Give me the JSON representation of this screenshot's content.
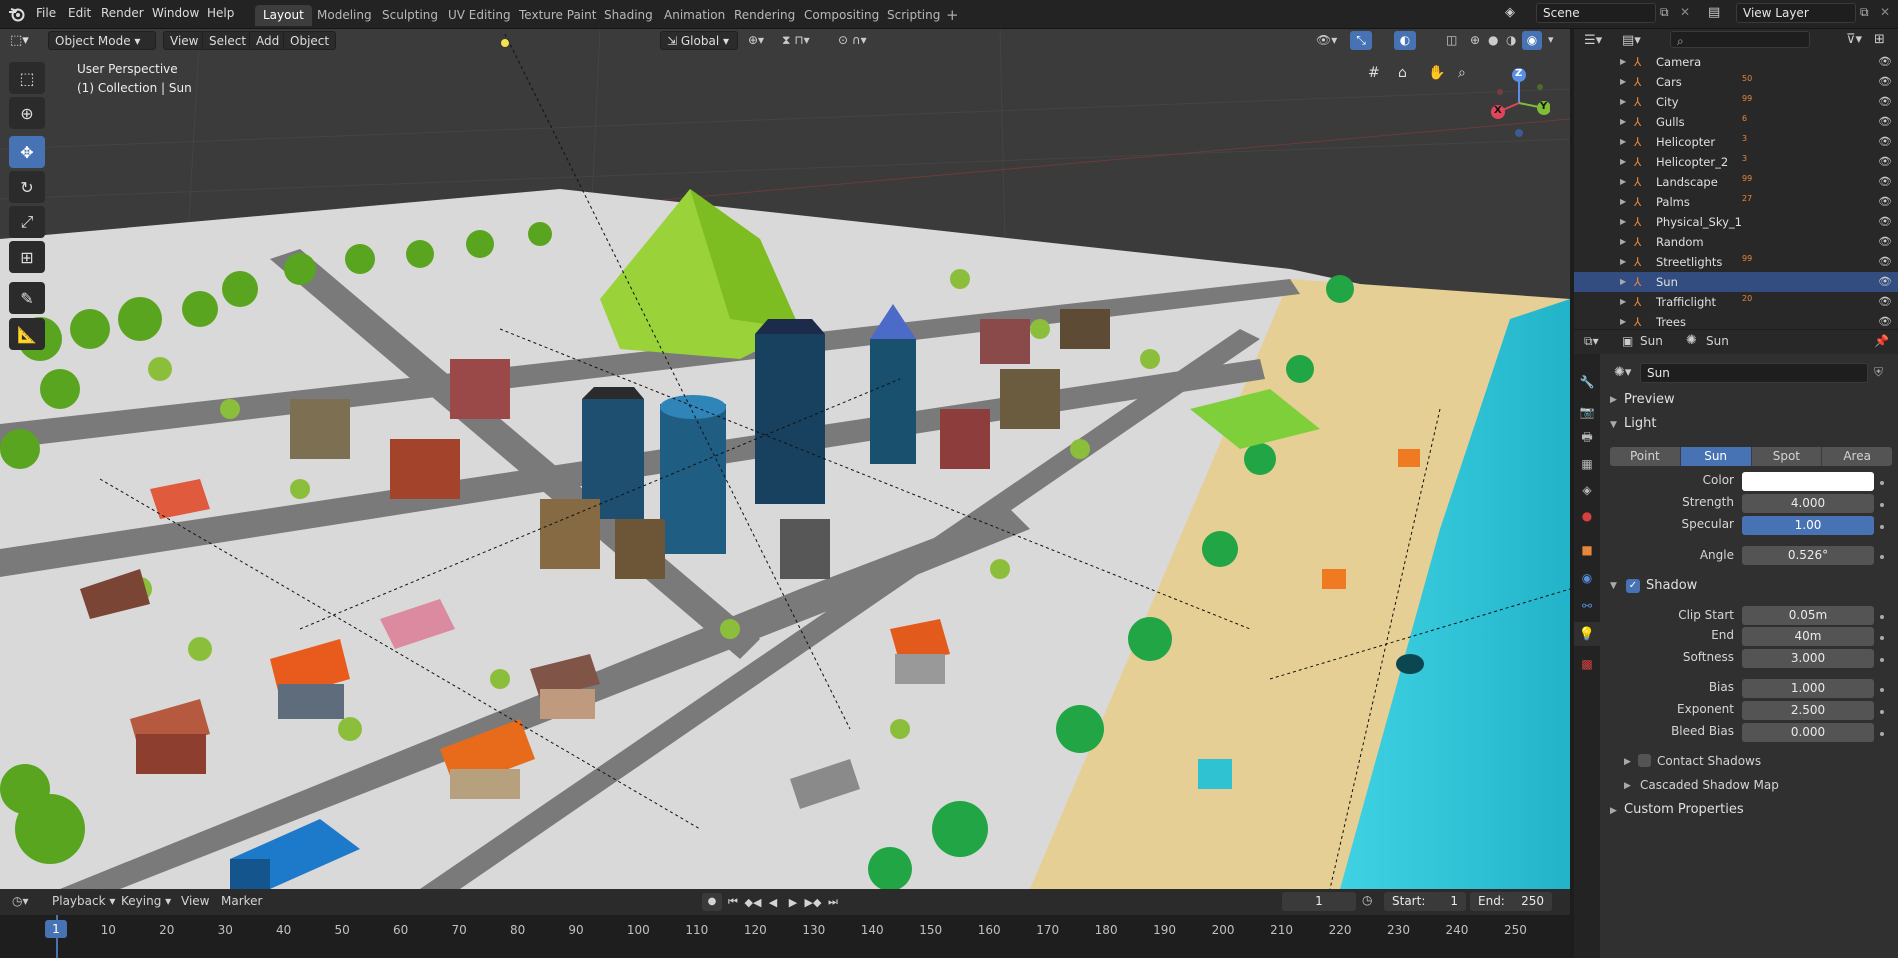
{
  "topbar": {
    "menus": [
      "File",
      "Edit",
      "Render",
      "Window",
      "Help"
    ],
    "workspaces": [
      "Layout",
      "Modeling",
      "Sculpting",
      "UV Editing",
      "Texture Paint",
      "Shading",
      "Animation",
      "Rendering",
      "Compositing",
      "Scripting"
    ],
    "active_workspace": "Layout",
    "scene_label": "Scene",
    "view_layer_label": "View Layer"
  },
  "viewport": {
    "mode": "Object Mode",
    "menus": [
      "View",
      "Select",
      "Add",
      "Object"
    ],
    "orientation": "Global",
    "overlay_title": "User Perspective",
    "overlay_subtitle": "(1) Collection | Sun",
    "gizmo_axes": {
      "x": "X",
      "y": "Y",
      "z": "Z"
    }
  },
  "outliner": {
    "search_placeholder": "",
    "items": [
      {
        "name": "Camera",
        "badge": ""
      },
      {
        "name": "Cars",
        "badge": "50"
      },
      {
        "name": "City",
        "badge": "99"
      },
      {
        "name": "Gulls",
        "badge": "6"
      },
      {
        "name": "Helicopter",
        "badge": "3"
      },
      {
        "name": "Helicopter_2",
        "badge": "3"
      },
      {
        "name": "Landscape",
        "badge": "99"
      },
      {
        "name": "Palms",
        "badge": "27"
      },
      {
        "name": "Physical_Sky_1",
        "badge": ""
      },
      {
        "name": "Random",
        "badge": ""
      },
      {
        "name": "Streetlights",
        "badge": "99"
      },
      {
        "name": "Sun",
        "badge": ""
      },
      {
        "name": "Trafficlight",
        "badge": "20"
      },
      {
        "name": "Trees",
        "badge": ""
      }
    ],
    "selected": "Sun"
  },
  "properties": {
    "breadcrumb_object": "Sun",
    "breadcrumb_data": "Sun",
    "datablock_name": "Sun",
    "preview_label": "Preview",
    "light_label": "Light",
    "light_types": [
      "Point",
      "Sun",
      "Spot",
      "Area"
    ],
    "active_light_type": "Sun",
    "color_label": "Color",
    "color_value": "#ffffff",
    "strength_label": "Strength",
    "strength": "4.000",
    "specular_label": "Specular",
    "specular": "1.00",
    "specular_fraction": 1.0,
    "angle_label": "Angle",
    "angle": "0.526°",
    "shadow_label": "Shadow",
    "shadow_enabled": true,
    "clip_start_label": "Clip Start",
    "clip_start": "0.05m",
    "end_label": "End",
    "end": "40m",
    "softness_label": "Softness",
    "softness": "3.000",
    "bias_label": "Bias",
    "bias": "1.000",
    "exponent_label": "Exponent",
    "exponent": "2.500",
    "bleed_bias_label": "Bleed Bias",
    "bleed_bias": "0.000",
    "contact_shadows_label": "Contact Shadows",
    "cascaded_label": "Cascaded Shadow Map",
    "custom_props_label": "Custom Properties"
  },
  "timeline": {
    "menus": [
      "Playback",
      "Keying",
      "View",
      "Marker"
    ],
    "current_frame": "1",
    "start_label": "Start:",
    "start": "1",
    "end_label": "End:",
    "end": "250",
    "ticks": [
      "1",
      "10",
      "20",
      "30",
      "40",
      "50",
      "60",
      "70",
      "80",
      "90",
      "100",
      "110",
      "120",
      "130",
      "140",
      "150",
      "160",
      "170",
      "180",
      "190",
      "200",
      "210",
      "220",
      "230",
      "240",
      "250"
    ]
  },
  "colors": {
    "accent": "#4772b3",
    "selection": "#334d80",
    "sea": "#30c3d8",
    "sand": "#e9d39a",
    "grass": "#7cc22a"
  }
}
